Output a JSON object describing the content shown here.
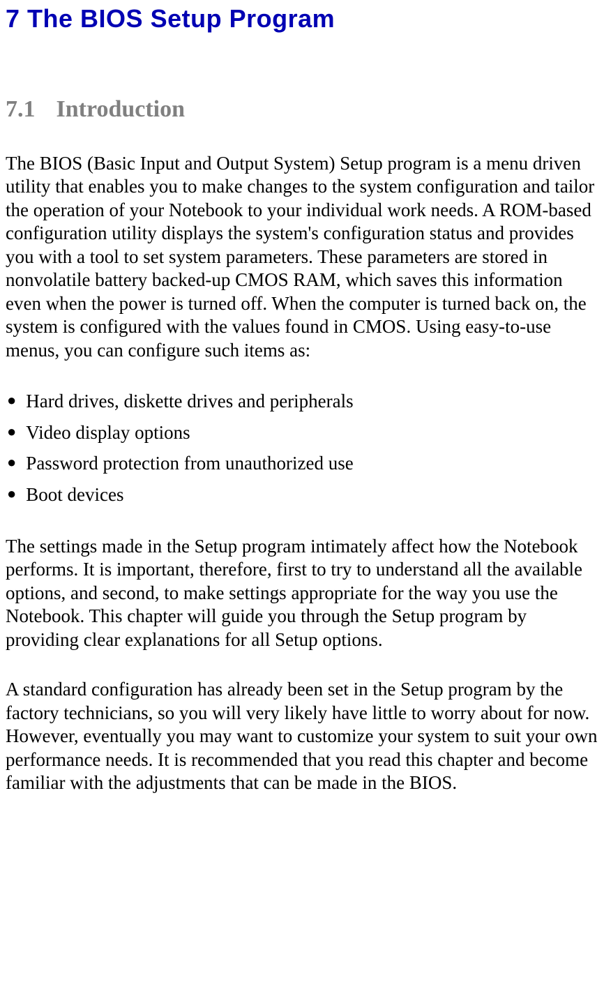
{
  "chapter": {
    "number": "7",
    "title": "The BIOS Setup Program"
  },
  "section": {
    "number": "7.1",
    "title": "Introduction"
  },
  "paragraphs": {
    "intro": "The BIOS (Basic Input and Output System) Setup program is a menu driven utility that enables you to make changes to the system configuration and tailor the operation of your Notebook to your individual work needs. A ROM-based configuration utility displays the system's configuration status and provides you with a tool to set system parameters. These parameters are stored in nonvolatile battery backed-up CMOS RAM, which saves this information even when the power is turned off. When the computer is turned back on, the system is configured with the values found in CMOS. Using easy-to-use menus, you can configure such items as:",
    "middle": "The settings made in the Setup program intimately affect how the Notebook performs. It is important, therefore, first to try to understand all the available options, and second, to make settings appropriate for the way you use the Notebook. This chapter will guide you through the Setup program by providing clear explanations for all Setup options.",
    "closing": "A standard configuration has already been set in the Setup program by the factory technicians, so you will very likely have little to worry about for now. However, eventually you may want to customize your system to suit your own performance needs. It is recommended that you read this chapter and become familiar with the adjustments that can be made in the BIOS."
  },
  "bullets": [
    "Hard drives, diskette drives and peripherals",
    "Video display options",
    "Password protection from unauthorized use",
    "Boot devices"
  ]
}
